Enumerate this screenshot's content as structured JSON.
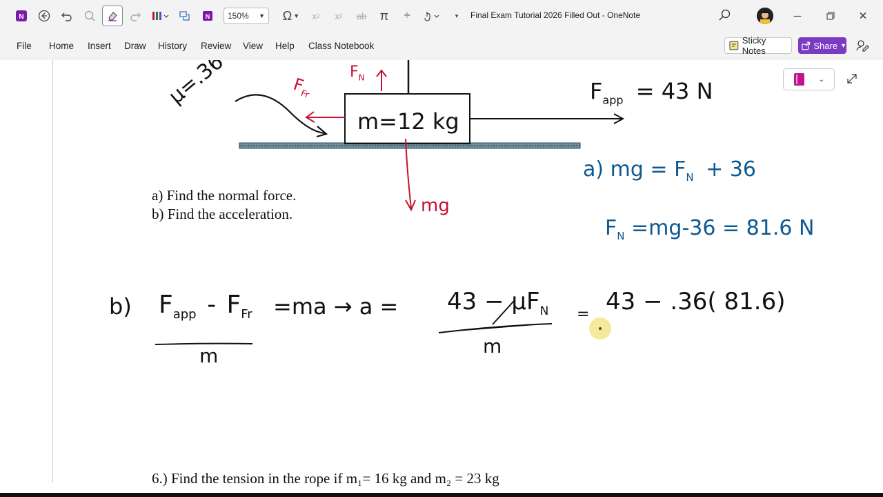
{
  "window": {
    "title": "Final Exam Tutorial 2026 Filled Out  -  OneNote",
    "zoom": "150%"
  },
  "menu": {
    "items": [
      "File",
      "Home",
      "Insert",
      "Draw",
      "History",
      "Review",
      "View",
      "Help",
      "Class Notebook"
    ],
    "sticky_notes": "Sticky Notes",
    "share": "Share"
  },
  "colors": {
    "accent": "#7b3ac2",
    "ink_black": "#111111",
    "ink_red": "#c8102e",
    "ink_blue": "#0c5a91"
  },
  "icons": {
    "search": "magnifier",
    "onenote": "onenote-logo",
    "omega": "Ω",
    "pi": "π"
  },
  "content": {
    "question_a": "a) Find the normal force.",
    "question_b": "b)  Find the acceleration.",
    "question_6": "6.) Find the tension in the rope if m₁= 16 kg and m₂ = 23 kg",
    "mu": "μ=.36",
    "mass_label": "m=12 kg",
    "fapp": "F",
    "fapp_sub": "app",
    "fapp_value": "= 43  N",
    "fn_label": "F",
    "fn_sub": "N",
    "ffr_label": "F",
    "ffr_sub": "Fr",
    "mg_label": "mg",
    "answer_a_line1": "a)  mg  =  F",
    "answer_a_line1_tail": "+ 36",
    "answer_a_line2": "=mg-36 = 81.6  N",
    "answer_b_prefix": "b)",
    "answer_b_eq": "=ma → a =",
    "answer_b_num": "43 − μF",
    "answer_b_den": "m",
    "answer_b_result": "43  − .36( 81.6)"
  }
}
